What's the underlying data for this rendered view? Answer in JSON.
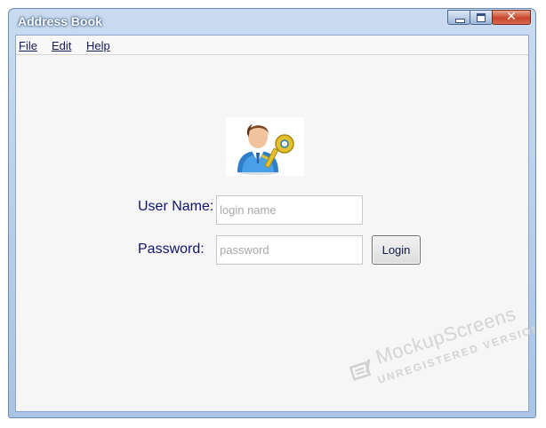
{
  "window": {
    "title": "Address Book"
  },
  "menu": {
    "items": [
      {
        "label": "File"
      },
      {
        "label": "Edit"
      },
      {
        "label": "Help"
      }
    ]
  },
  "login": {
    "icon": "user-with-key-icon",
    "username_label": "User Name:",
    "username_placeholder": "login name",
    "username_value": "",
    "password_label": "Password:",
    "password_placeholder": "password",
    "password_value": "",
    "login_button": "Login"
  },
  "watermark": {
    "brand": "MockupScreens",
    "subtitle": "UNREGISTERED VERSION"
  },
  "colors": {
    "title_bar": "#b5cce9",
    "label_text": "#12126b",
    "client_background": "#f6f6f6",
    "close_button": "#c8452c"
  }
}
